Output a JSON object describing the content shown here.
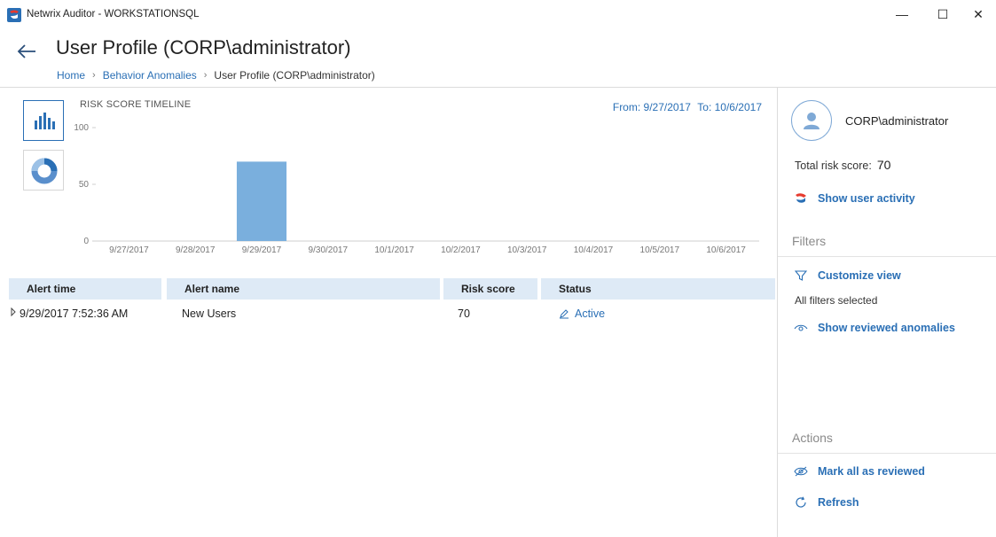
{
  "window": {
    "title": "Netwrix Auditor - WORKSTATIONSQL",
    "minimize": "—",
    "maximize": "☐",
    "close": "✕"
  },
  "header": {
    "title": "User Profile (CORP\\administrator)",
    "breadcrumb": {
      "home": "Home",
      "anomalies": "Behavior Anomalies",
      "current": "User Profile (CORP\\administrator)",
      "separator": "›"
    }
  },
  "chart_header": {
    "title": "RISK SCORE TIMELINE",
    "from": "From: 9/27/2017",
    "to": "To: 10/6/2017"
  },
  "chart_data": {
    "type": "bar",
    "title": "RISK SCORE TIMELINE",
    "categories": [
      "9/27/2017",
      "9/28/2017",
      "9/29/2017",
      "9/30/2017",
      "10/1/2017",
      "10/2/2017",
      "10/3/2017",
      "10/4/2017",
      "10/5/2017",
      "10/6/2017"
    ],
    "values": [
      0,
      0,
      70,
      0,
      0,
      0,
      0,
      0,
      0,
      0
    ],
    "yticks": [
      0,
      50,
      100
    ],
    "ylim": [
      0,
      100
    ],
    "grid": false,
    "bar_color": "#7aafdd"
  },
  "table": {
    "headers": {
      "alert_time": "Alert time",
      "alert_name": "Alert name",
      "risk_score": "Risk score",
      "status": "Status"
    },
    "rows": [
      {
        "alert_time": "9/29/2017 7:52:36 AM",
        "alert_name": "New Users",
        "risk_score": "70",
        "status": "Active"
      }
    ]
  },
  "side_panel": {
    "user_name": "CORP\\administrator",
    "total_risk_label": "Total risk score:",
    "total_risk_value": "70",
    "show_user_activity": "Show user activity",
    "filters_title": "Filters",
    "customize_view": "Customize view",
    "all_filters": "All filters selected",
    "show_reviewed": "Show reviewed anomalies",
    "actions_title": "Actions",
    "mark_all_reviewed": "Mark all as reviewed",
    "refresh": "Refresh"
  },
  "colors": {
    "accent": "#2a6fb5",
    "bar": "#7aafdd",
    "header_fill": "#deeaf6"
  }
}
